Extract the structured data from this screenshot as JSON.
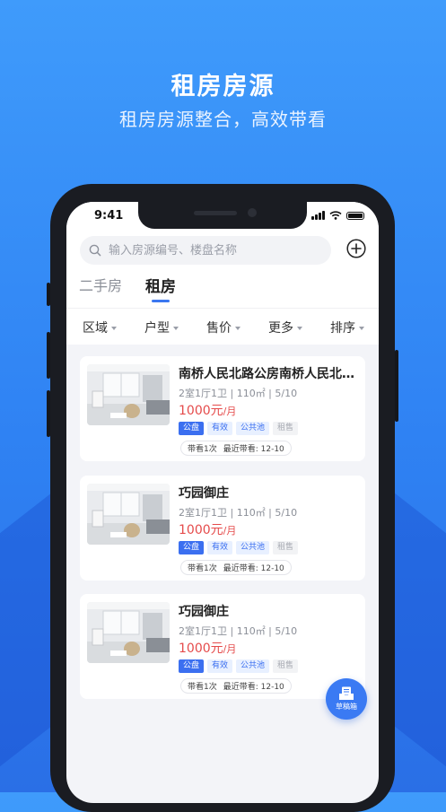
{
  "promo": {
    "title": "租房房源",
    "subtitle": "租房房源整合，高效带看"
  },
  "status_bar": {
    "time": "9:41"
  },
  "search": {
    "placeholder": "输入房源编号、楼盘名称"
  },
  "tabs": [
    {
      "label": "二手房",
      "active": false
    },
    {
      "label": "租房",
      "active": true
    }
  ],
  "filters": [
    "区域",
    "户型",
    "售价",
    "更多",
    "排序"
  ],
  "listings": [
    {
      "title": "南桥人民北路公房南桥人民北路公房",
      "spec": "2室1厅1卫 | 110㎡ | 5/10",
      "price": "1000元",
      "price_unit": "/月",
      "tags": [
        "公盘",
        "有效",
        "公共池",
        "租售"
      ],
      "visits": "带看1次",
      "last_visit": "最近带看: 12-10"
    },
    {
      "title": "巧园御庄",
      "spec": "2室1厅1卫 | 110㎡ | 5/10",
      "price": "1000元",
      "price_unit": "/月",
      "tags": [
        "公盘",
        "有效",
        "公共池",
        "租售"
      ],
      "visits": "带看1次",
      "last_visit": "最近带看: 12-10"
    },
    {
      "title": "巧园御庄",
      "spec": "2室1厅1卫 | 110㎡ | 5/10",
      "price": "1000元",
      "price_unit": "/月",
      "tags": [
        "公盘",
        "有效",
        "公共池",
        "租售"
      ],
      "visits": "带看1次",
      "last_visit": "最近带看: 12-10"
    }
  ],
  "fab": {
    "label": "草稿箱",
    "icon": "draft-box-icon"
  },
  "colors": {
    "accent": "#3b6ff0",
    "price": "#e54b4b",
    "background": "#3f9bfb"
  }
}
